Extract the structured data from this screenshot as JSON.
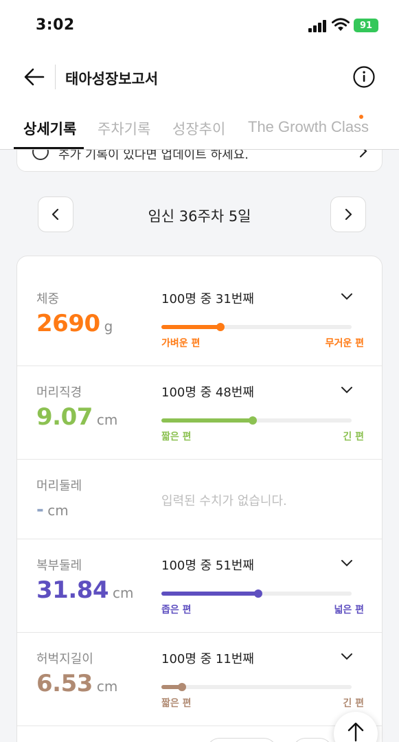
{
  "status_bar": {
    "time": "3:02",
    "battery": "91"
  },
  "header": {
    "title": "태아성장보고서"
  },
  "tabs": [
    {
      "label": "상세기록",
      "active": true
    },
    {
      "label": "주차기록",
      "active": false
    },
    {
      "label": "성장추이",
      "active": false
    },
    {
      "label": "The Growth Class",
      "active": false,
      "has_new_dot": true
    }
  ],
  "notice": {
    "text": "추가 기록이 있다면 업데이트 하세요."
  },
  "date_nav": {
    "label": "임신 36주차 5일"
  },
  "metrics": [
    {
      "label": "체중",
      "value": "2690",
      "unit": "g",
      "rank": "100명 중 31번째",
      "position": 0.31,
      "low_label": "가벼운 편",
      "high_label": "무거운 편",
      "color": "#ff7a14"
    },
    {
      "label": "머리직경",
      "value": "9.07",
      "unit": "cm",
      "rank": "100명 중 48번째",
      "position": 0.48,
      "low_label": "짧은 편",
      "high_label": "긴 편",
      "color": "#8cc152"
    },
    {
      "label": "머리둘레",
      "value": "-",
      "unit": "cm",
      "empty_message": "입력된 수치가 없습니다.",
      "color": "#8fa3c4"
    },
    {
      "label": "복부둘레",
      "value": "31.84",
      "unit": "cm",
      "rank": "100명 중 51번째",
      "position": 0.51,
      "low_label": "좁은 편",
      "high_label": "넓은 편",
      "color": "#5e4fc0"
    },
    {
      "label": "허벅지길이",
      "value": "6.53",
      "unit": "cm",
      "rank": "100명 중 11번째",
      "position": 0.11,
      "low_label": "짧은 편",
      "high_label": "긴 편",
      "color": "#b08a72"
    }
  ]
}
